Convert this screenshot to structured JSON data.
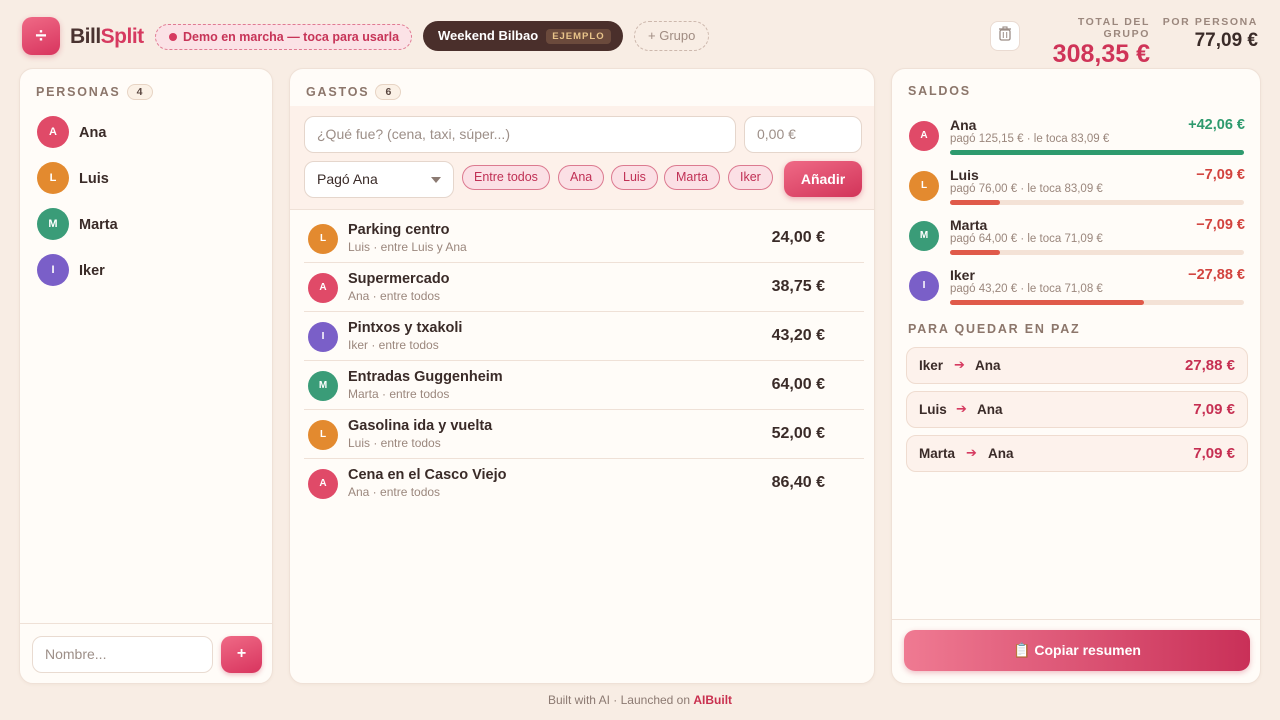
{
  "header": {
    "logo_glyph": "÷",
    "brand_part1": "Bill",
    "brand_part2": "Split",
    "demo_label": "Demo en marcha — toca para usarla",
    "group_name": "Weekend Bilbao",
    "group_tag": "EJEMPLO",
    "add_group_label": "+ Grupo",
    "trash_icon": "trash-icon",
    "total_label": "TOTAL DEL GRUPO",
    "total_value": "308,35 €",
    "per_person_label": "POR PERSONA",
    "per_person_value": "77,09 €"
  },
  "colors": {
    "accent": "#d63a60",
    "ana": "#e04a68",
    "luis": "#e38a2f",
    "marta": "#3a9c78",
    "iker": "#7a5fc8",
    "positive": "#2e9a6e",
    "negative": "#d2433e"
  },
  "people_panel": {
    "title": "PERSONAS",
    "count": "4",
    "people": [
      {
        "initial": "A",
        "name": "Ana"
      },
      {
        "initial": "L",
        "name": "Luis"
      },
      {
        "initial": "M",
        "name": "Marta"
      },
      {
        "initial": "I",
        "name": "Iker"
      }
    ],
    "name_placeholder": "Nombre...",
    "add_label": "+"
  },
  "expenses_panel": {
    "title": "GASTOS",
    "count": "6",
    "desc_placeholder": "¿Qué fue? (cena, taxi, súper...)",
    "amount_placeholder": "0,00 €",
    "payer_selected": "Pagó Ana",
    "chips": [
      "Entre todos",
      "Ana",
      "Luis",
      "Marta",
      "Iker"
    ],
    "add_label": "Añadir",
    "expenses": [
      {
        "initial": "L",
        "title": "Parking centro",
        "sub": "Luis · entre Luis y Ana",
        "amount": "24,00 €"
      },
      {
        "initial": "A",
        "title": "Supermercado",
        "sub": "Ana · entre todos",
        "amount": "38,75 €"
      },
      {
        "initial": "I",
        "title": "Pintxos y txakoli",
        "sub": "Iker · entre todos",
        "amount": "43,20 €"
      },
      {
        "initial": "M",
        "title": "Entradas Guggenheim",
        "sub": "Marta · entre todos",
        "amount": "64,00 €"
      },
      {
        "initial": "L",
        "title": "Gasolina ida y vuelta",
        "sub": "Luis · entre todos",
        "amount": "52,00 €"
      },
      {
        "initial": "A",
        "title": "Cena en el Casco Viejo",
        "sub": "Ana · entre todos",
        "amount": "86,40 €"
      }
    ]
  },
  "balances_panel": {
    "title": "SALDOS",
    "balances": [
      {
        "initial": "A",
        "name": "Ana",
        "sub": "pagó 125,15 € · le toca 83,09 €",
        "value": "+42,06 €",
        "level": 1.0
      },
      {
        "initial": "L",
        "name": "Luis",
        "sub": "pagó 76,00 € · le toca 83,09 €",
        "value": "−7,09 €",
        "level": 0.17
      },
      {
        "initial": "M",
        "name": "Marta",
        "sub": "pagó 64,00 € · le toca 71,09 €",
        "value": "−7,09 €",
        "level": 0.17
      },
      {
        "initial": "I",
        "name": "Iker",
        "sub": "pagó 43,20 € · le toca 71,08 €",
        "value": "−27,88 €",
        "level": 0.66
      }
    ],
    "settle_title": "PARA QUEDAR EN PAZ",
    "settlements": [
      {
        "from": "Iker",
        "to": "Ana",
        "amount": "27,88 €"
      },
      {
        "from": "Luis",
        "to": "Ana",
        "amount": "7,09 €"
      },
      {
        "from": "Marta",
        "to": "Ana",
        "amount": "7,09 €"
      }
    ],
    "copy_label": "📋 Copiar resumen"
  },
  "footer": {
    "text": "Built with AI · Launched on ",
    "link": "AIBuilt"
  }
}
